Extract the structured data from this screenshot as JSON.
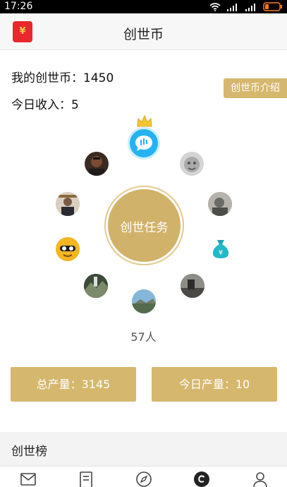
{
  "status_bar": {
    "time": "17:26",
    "icons": [
      "wifi-icon",
      "signal-icon",
      "signal-icon",
      "battery-icon"
    ]
  },
  "header": {
    "title": "创世币",
    "app_icon_symbol": "¥",
    "app_icon_color": "#e8282d"
  },
  "summary": {
    "coin_total": "我的创世币：1450",
    "today_income": "今日收入：5"
  },
  "intro_button": "创世币介绍",
  "center_task": "创世任务",
  "participants": "57人",
  "stats": {
    "total_output": "总产量：3145",
    "today_output": "今日产量：10"
  },
  "ranking": {
    "title": "创世榜"
  },
  "tabs": [
    "mail-icon",
    "notes-icon",
    "compass-icon",
    "coin-icon",
    "profile-icon"
  ],
  "colors": {
    "gold": "#d5b76e",
    "ring": "#d1b26a",
    "crown": "#f5c431",
    "chat_bubble": "#24b3f0"
  }
}
